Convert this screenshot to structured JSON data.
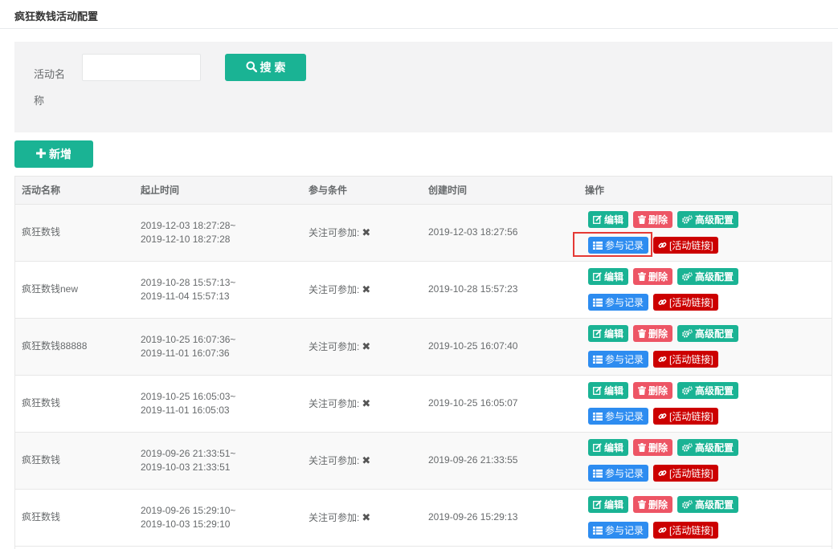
{
  "page": {
    "title": "疯狂数钱活动配置"
  },
  "search": {
    "label": "活动名称",
    "value": "",
    "placeholder": "",
    "button_label": "搜 索"
  },
  "actions": {
    "add_label": "新增"
  },
  "table": {
    "columns": [
      "活动名称",
      "起止时间",
      "参与条件",
      "创建时间",
      "操作"
    ],
    "rows": [
      {
        "name": "疯狂数钱",
        "start": "2019-12-03 18:27:28~",
        "end": "2019-12-10 18:27:28",
        "condition": "关注可参加:",
        "created": "2019-12-03 18:27:56"
      },
      {
        "name": "疯狂数钱new",
        "start": "2019-10-28 15:57:13~",
        "end": "2019-11-04 15:57:13",
        "condition": "关注可参加:",
        "created": "2019-10-28 15:57:23"
      },
      {
        "name": "疯狂数钱88888",
        "start": "2019-10-25 16:07:36~",
        "end": "2019-11-01 16:07:36",
        "condition": "关注可参加:",
        "created": "2019-10-25 16:07:40"
      },
      {
        "name": "疯狂数钱",
        "start": "2019-10-25 16:05:03~",
        "end": "2019-11-01 16:05:03",
        "condition": "关注可参加:",
        "created": "2019-10-25 16:05:07"
      },
      {
        "name": "疯狂数钱",
        "start": "2019-09-26 21:33:51~",
        "end": "2019-10-03 21:33:51",
        "condition": "关注可参加:",
        "created": "2019-09-26 21:33:55"
      },
      {
        "name": "疯狂数钱",
        "start": "2019-09-26 15:29:10~",
        "end": "2019-10-03 15:29:10",
        "condition": "关注可参加:",
        "created": "2019-09-26 15:29:13"
      }
    ],
    "row_buttons": {
      "edit": "编辑",
      "delete": "删除",
      "advanced": "高级配置",
      "records": "参与记录",
      "link": "[活动链接]"
    }
  },
  "colors": {
    "primary": "#1ab394",
    "danger": "#ed5565",
    "info": "#2d8cf0",
    "link": "#cc0000",
    "highlight": "#e53935"
  }
}
